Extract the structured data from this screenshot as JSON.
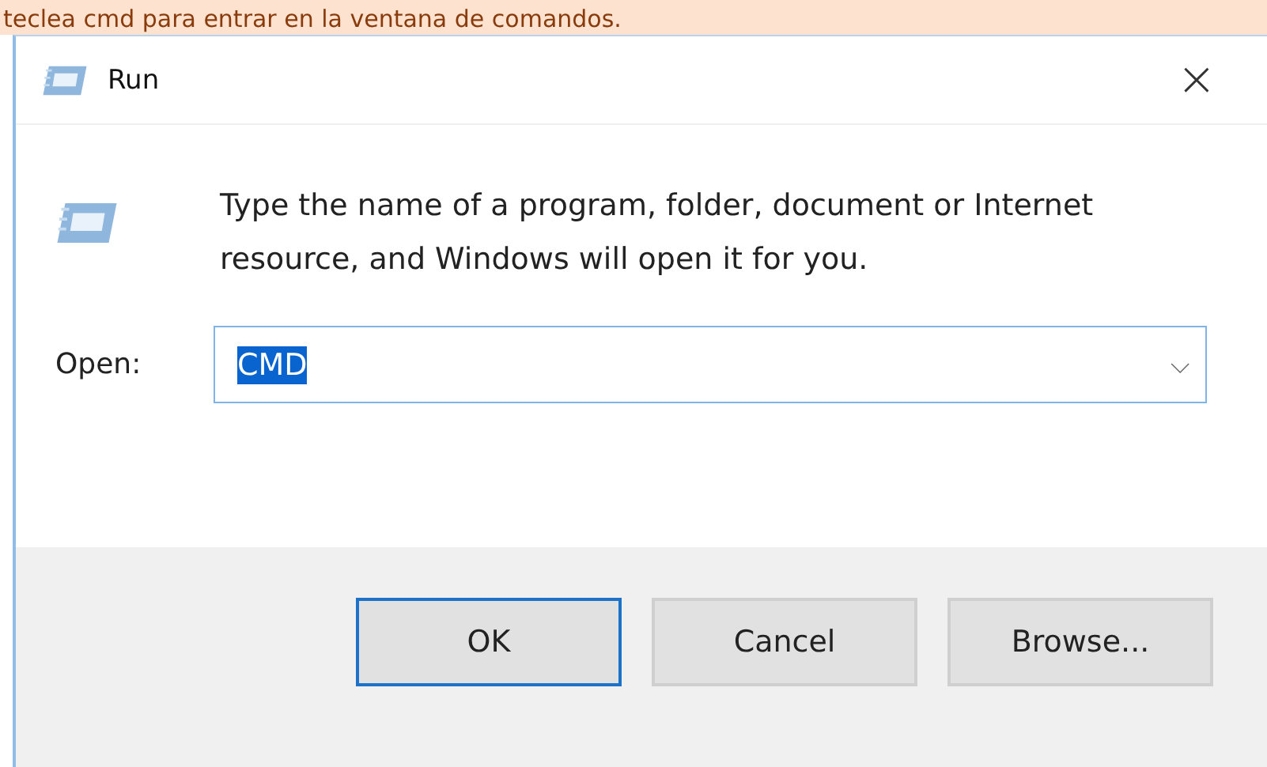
{
  "banner": {
    "text": "teclea cmd para entrar en la ventana de comandos."
  },
  "window": {
    "title": "Run",
    "close": "×"
  },
  "prompt": "Type the name of a program, folder, document or Internet resource, and Windows will open it for you.",
  "open_field": {
    "label": "Open:",
    "value": "CMD",
    "value_selected": true,
    "dropdown": "⌵"
  },
  "buttons": [
    {
      "label": "OK",
      "default": true
    },
    {
      "label": "Cancel",
      "default": false
    },
    {
      "label": "Browse...",
      "default": false
    }
  ]
}
